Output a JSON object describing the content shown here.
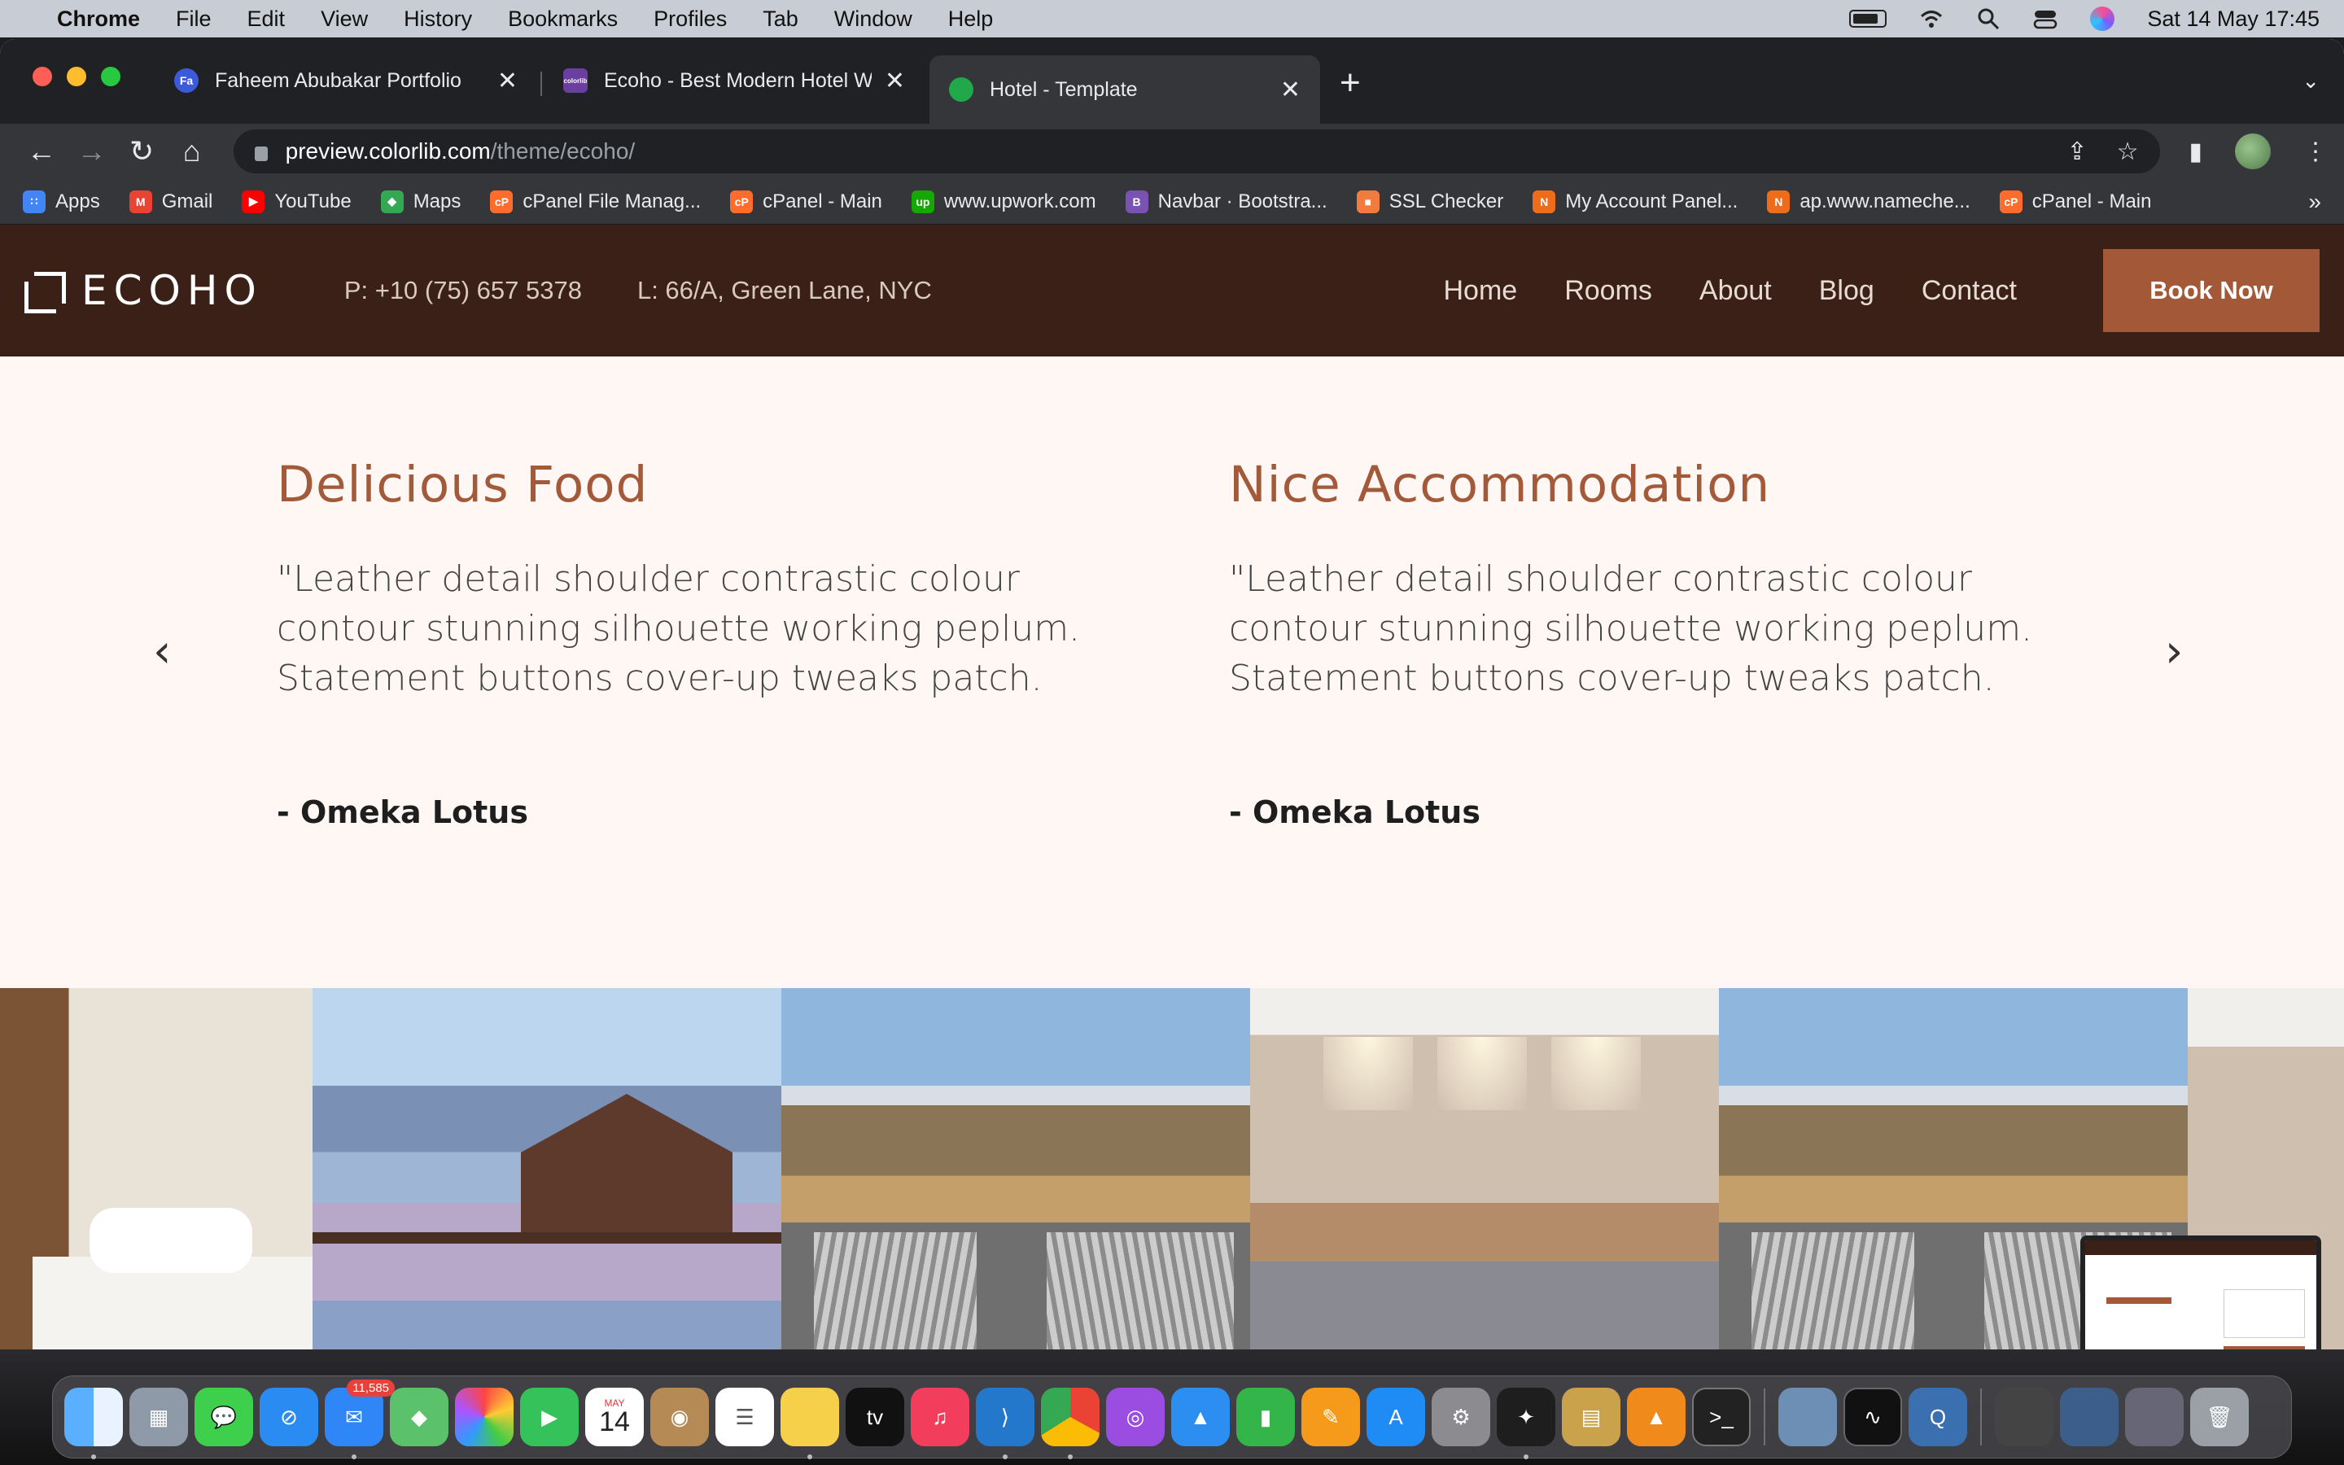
{
  "menubar": {
    "app": "Chrome",
    "items": [
      "File",
      "Edit",
      "View",
      "History",
      "Bookmarks",
      "Profiles",
      "Tab",
      "Window",
      "Help"
    ],
    "datetime": "Sat 14 May  17:45"
  },
  "browser": {
    "tabs": [
      {
        "title": "Faheem Abubakar Portfolio",
        "favicon": "Fa"
      },
      {
        "title": "Ecoho - Best Modern Hotel We",
        "favicon": "colorlib"
      },
      {
        "title": "Hotel - Template",
        "favicon": "check"
      }
    ],
    "url_host": "preview.colorlib.com",
    "url_path": "/theme/ecoho/",
    "bookmarks": [
      {
        "label": "Apps",
        "color": "#4285f4",
        "ic": "∷"
      },
      {
        "label": "Gmail",
        "color": "#ea4335",
        "ic": "M"
      },
      {
        "label": "YouTube",
        "color": "#ff0000",
        "ic": "▶"
      },
      {
        "label": "Maps",
        "color": "#34a853",
        "ic": "◆"
      },
      {
        "label": "cPanel File Manag...",
        "color": "#ff6c2c",
        "ic": "cP"
      },
      {
        "label": "cPanel - Main",
        "color": "#ff6c2c",
        "ic": "cP"
      },
      {
        "label": "www.upwork.com",
        "color": "#14a800",
        "ic": "up"
      },
      {
        "label": "Navbar · Bootstra...",
        "color": "#7952b3",
        "ic": "B"
      },
      {
        "label": "SSL Checker",
        "color": "#f47b3e",
        "ic": "■"
      },
      {
        "label": "My Account Panel...",
        "color": "#ef6c1a",
        "ic": "N"
      },
      {
        "label": "ap.www.nameche...",
        "color": "#ef6c1a",
        "ic": "N"
      },
      {
        "label": "cPanel - Main",
        "color": "#ff6c2c",
        "ic": "cP"
      }
    ],
    "more": "»"
  },
  "site": {
    "logo": "ECOHO",
    "phone": "P: +10 (75) 657 5378",
    "location": "L: 66/A, Green Lane, NYC",
    "nav": [
      "Home",
      "Rooms",
      "About",
      "Blog",
      "Contact"
    ],
    "cta": "Book Now",
    "testimonials": [
      {
        "title": "Delicious Food",
        "quote": "\"Leather detail shoulder contrastic colour contour stunning silhouette working peplum. Statement buttons cover-up tweaks patch.",
        "author": "- Omeka Lotus"
      },
      {
        "title": "Nice Accommodation",
        "quote": "\"Leather detail shoulder contrastic colour contour stunning silhouette working peplum. Statement buttons cover-up tweaks patch.",
        "author": "- Omeka Lotus"
      }
    ],
    "prev_icon": "‹",
    "next_icon": "›"
  },
  "dock": {
    "mail_badge": "11,585",
    "calendar_month": "MAY",
    "calendar_day": "14"
  },
  "colors": {
    "header_bg": "#3a2016",
    "accent": "#a35838",
    "page_bg": "#fff7f3"
  }
}
